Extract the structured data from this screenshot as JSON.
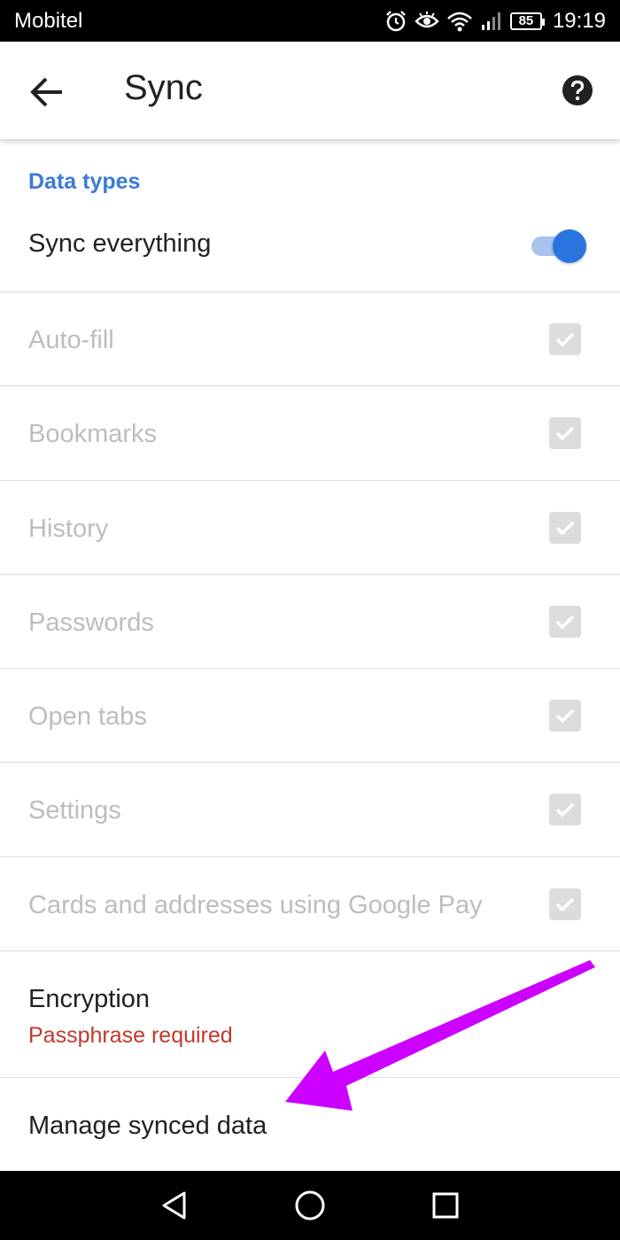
{
  "status_bar": {
    "carrier": "Mobitel",
    "battery": "85",
    "time": "19:19",
    "icons": [
      "alarm-icon",
      "eye-icon",
      "wifi-icon",
      "signal-icon",
      "battery-icon"
    ]
  },
  "app_bar": {
    "title": "Sync",
    "back_icon": "arrow-back-icon",
    "help_icon": "help-circle-icon"
  },
  "section_header": "Data types",
  "sync_everything": {
    "label": "Sync everything",
    "toggle_on": true,
    "accent_color": "#2a74e0"
  },
  "data_types": [
    {
      "label": "Auto-fill",
      "checked": true,
      "enabled": false
    },
    {
      "label": "Bookmarks",
      "checked": true,
      "enabled": false
    },
    {
      "label": "History",
      "checked": true,
      "enabled": false
    },
    {
      "label": "Passwords",
      "checked": true,
      "enabled": false
    },
    {
      "label": "Open tabs",
      "checked": true,
      "enabled": false
    },
    {
      "label": "Settings",
      "checked": true,
      "enabled": false
    },
    {
      "label": "Cards and addresses using Google Pay",
      "checked": true,
      "enabled": false
    }
  ],
  "encryption": {
    "label": "Encryption",
    "status": "Passphrase required",
    "status_color": "#c0392b"
  },
  "manage_synced_data": {
    "label": "Manage synced data"
  },
  "annotation": {
    "color": "#cc00ff",
    "points_to": "Manage synced data"
  },
  "nav_bar": {
    "buttons": [
      "back-triangle-icon",
      "home-circle-icon",
      "recents-square-icon"
    ]
  }
}
